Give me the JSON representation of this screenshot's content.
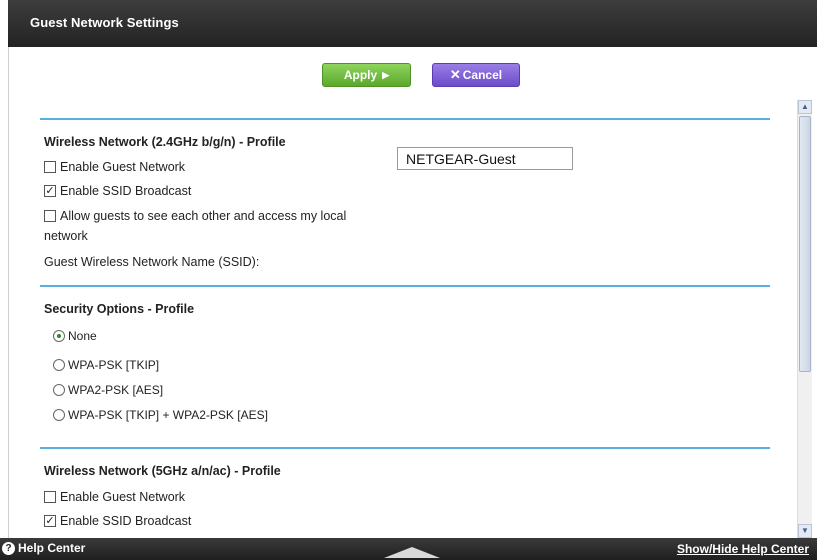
{
  "header": {
    "title": "Guest Network Settings"
  },
  "actions": {
    "apply_label": "Apply",
    "cancel_label": "Cancel"
  },
  "wireless24": {
    "section_title": "Wireless Network (2.4GHz b/g/n) - Profile",
    "enable_guest_label": "Enable Guest Network",
    "enable_guest_checked": false,
    "ssid_broadcast_label": "Enable SSID Broadcast",
    "ssid_broadcast_checked": true,
    "allow_guests_label_line1": "Allow guests to see each other and access my local",
    "allow_guests_label_line2": "network",
    "allow_guests_checked": false,
    "ssid_label": "Guest Wireless Network Name (SSID):",
    "ssid_value": "NETGEAR-Guest"
  },
  "security": {
    "section_title": "Security Options - Profile",
    "options": [
      "None",
      "WPA-PSK [TKIP]",
      "WPA2-PSK [AES]",
      "WPA-PSK [TKIP] + WPA2-PSK [AES]"
    ],
    "selected": "None"
  },
  "wireless5": {
    "section_title": "Wireless Network (5GHz a/n/ac) - Profile",
    "enable_guest_label": "Enable Guest Network",
    "enable_guest_checked": false,
    "ssid_broadcast_label": "Enable SSID Broadcast",
    "ssid_broadcast_checked": true
  },
  "footer": {
    "help_center_label": "Help Center",
    "toggle_label": "Show/Hide Help Center"
  },
  "colors": {
    "apply": "#6cbd3d",
    "cancel": "#7b5cd6",
    "divider": "#5aaee0",
    "titlebar": "#2e2e2e"
  }
}
